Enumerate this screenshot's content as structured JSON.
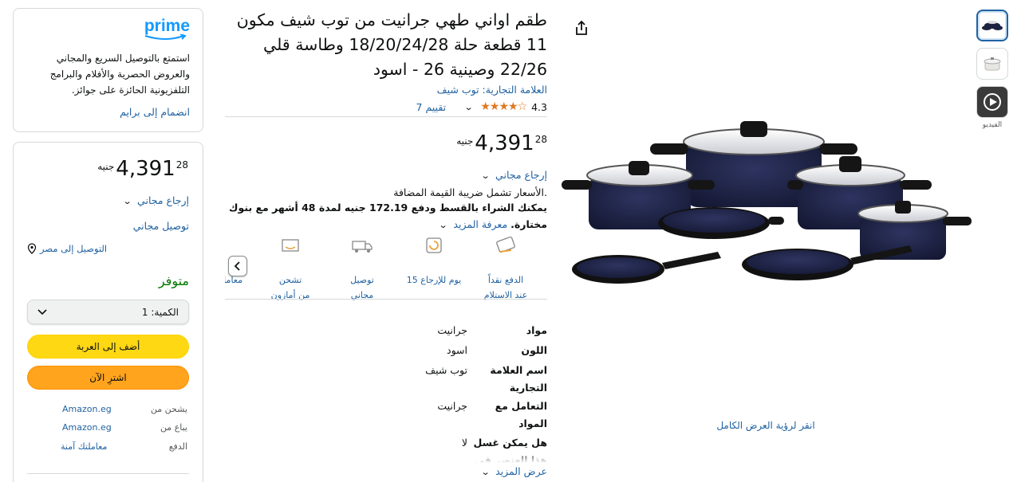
{
  "product": {
    "title": "طقم اواني طهي جرانيت من توب شيف مكون 11 قطعة حلة 18/20/24/28 وطاسة قلي 22/26 وصينية 26 - اسود",
    "brand": "العلامة التجارية: توب شيف",
    "rating_value": "4.3",
    "stars": "★★★★☆",
    "ratings_count": "7 تقييم",
    "price_currency": "جنيه",
    "price_whole": "4,391",
    "price_fraction": "28",
    "free_returns": "إرجاع مجاني",
    "vat_note": ".الأسعار تشمل ضريبة القيمة المضافة",
    "installment_line1": "يمكنك الشراء بالقسط ودفع 172.19 جنيه لمدة 48 أشهر مع بنوك",
    "installment_line2": "مختارة.",
    "learn_more": "معرفة المزيد",
    "view_full": "انقر لرؤية العرض الكامل",
    "video_label": "الفيديو"
  },
  "features": [
    {
      "icon": "cash-on-delivery-icon",
      "line1": "الدفع نقداً",
      "line2": "عند الاستلام"
    },
    {
      "icon": "returns-15-days-icon",
      "line1": "15 يوم للإرجاع",
      "line2": ""
    },
    {
      "icon": "free-delivery-icon",
      "line1": "توصيل",
      "line2": "مجاني"
    },
    {
      "icon": "ships-from-amazon-icon",
      "line1": "تشحن",
      "line2": "من أمازون"
    },
    {
      "icon": "secure-transaction-icon",
      "line1": "معاملة",
      "line2": ""
    }
  ],
  "specs": [
    {
      "key": "مواد",
      "value": "جرانيت"
    },
    {
      "key": "اللون",
      "value": "اسود"
    },
    {
      "key": "اسم العلامة التجارية",
      "value": "توب شيف"
    },
    {
      "key": "التعامل مع المواد",
      "value": "جرانيت"
    },
    {
      "key": "هل يمكن غسل هذا العنصر في",
      "value": "لا"
    }
  ],
  "show_more": "عرض المزيد",
  "prime": {
    "logo": "prime",
    "text": "استمتع بالتوصيل السريع والمجاني والعروض الحصرية والأفلام والبرامج التلفزيونية الحائزة على جوائز.",
    "join": "انضمام إلى برايم"
  },
  "buybox": {
    "price_currency": "جنيه",
    "price_whole": "4,391",
    "price_fraction": "28",
    "free_returns": "إرجاع مجاني",
    "free_delivery": "توصيل مجاني",
    "deliver_to": "التوصيل إلى مصر",
    "in_stock": "متوفر",
    "quantity_label": "الكمية:",
    "quantity_value": "1",
    "add_to_cart": "أضف إلى العربة",
    "buy_now": "اشترِ الآن",
    "ships_from_label": "يشحن من",
    "ships_from_value": "Amazon.eg",
    "sold_by_label": "يباع من",
    "sold_by_value": "Amazon.eg",
    "payment_label": "الدفع",
    "payment_value": "معاملتك آمنة"
  },
  "colors": {
    "link": "#2162a1",
    "in_stock": "#007600",
    "cart_button": "#ffd814",
    "buy_button": "#ffa41c",
    "stars": "#de7921"
  }
}
